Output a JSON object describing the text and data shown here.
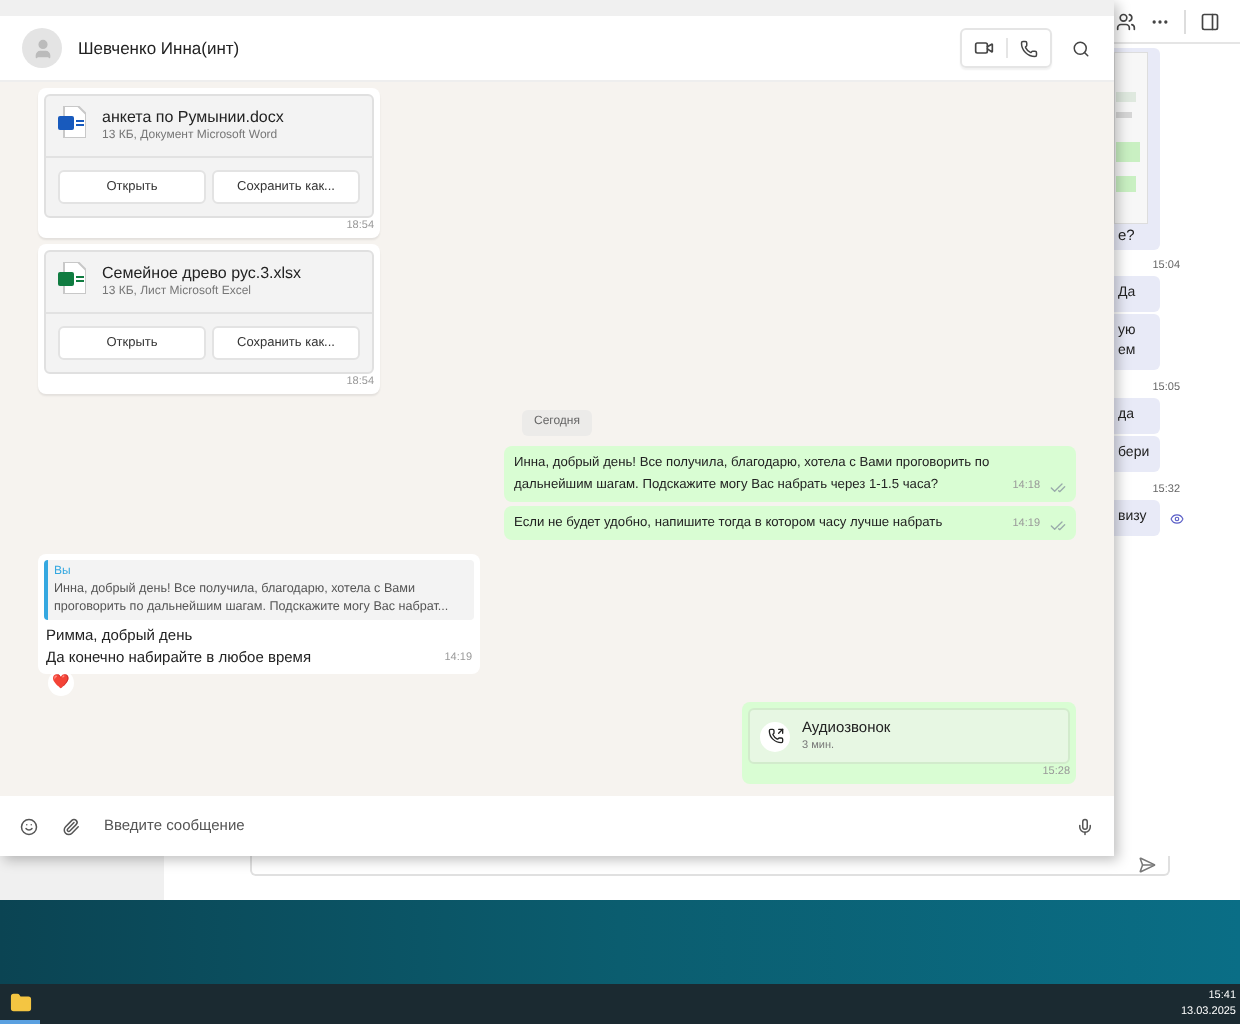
{
  "window": {
    "contact": "Шевченко Инна(инт)"
  },
  "messages": [
    {
      "kind": "file",
      "outgoing": false,
      "icon": {
        "kind": "word"
      },
      "name": "анкета по Румынии.docx",
      "meta": "13 КБ, Документ Microsoft Word",
      "buttons": [
        "Открыть",
        "Сохранить как..."
      ],
      "time": "18:54"
    },
    {
      "kind": "file",
      "outgoing": false,
      "icon": {
        "kind": "excel"
      },
      "name": "Семейное древо рус.3.xlsx",
      "meta": "13 КБ, Лист Microsoft Excel",
      "buttons": [
        "Открыть",
        "Сохранить как..."
      ],
      "time": "18:54"
    },
    {
      "kind": "date",
      "text": "Сегодня"
    },
    {
      "kind": "text",
      "outgoing": true,
      "text": "Инна, добрый день! Все получила, благодарю, хотела с Вами проговорить по дальнейшим шагам. Подскажите могу Вас набрать через 1-1.5 часа?",
      "time": "14:18",
      "read": false
    },
    {
      "kind": "text",
      "outgoing": true,
      "text": "Если не будет удобно, напишите тогда в котором часу лучше набрать",
      "time": "14:19",
      "read": false
    },
    {
      "kind": "reply",
      "outgoing": false,
      "quote_author": "Вы",
      "quote_text": "Инна, добрый день! Все получила, благодарю, хотела с Вами проговорить по дальнейшим шагам. Подскажите могу Вас набрат...",
      "lines": [
        "Римма, добрый день",
        "Да конечно набирайте в любое время"
      ],
      "time": "14:19",
      "reaction": "❤️"
    },
    {
      "kind": "call",
      "outgoing": true,
      "title": "Аудиозвонок",
      "duration": "3 мин.",
      "time": "15:28"
    }
  ],
  "composer": {
    "placeholder": "Введите сообщение"
  },
  "background_chat": [
    {
      "text": "е?"
    },
    {
      "kind": "time",
      "text": "15:04"
    },
    {
      "kind": "bubble",
      "lines": [
        "Да"
      ]
    },
    {
      "kind": "bubble",
      "lines": [
        "ую",
        "ем"
      ]
    },
    {
      "kind": "time",
      "text": "15:05"
    },
    {
      "kind": "bubble",
      "lines": [
        "да"
      ]
    },
    {
      "kind": "bubble",
      "lines": [
        "бери"
      ]
    },
    {
      "kind": "time",
      "text": "15:32"
    },
    {
      "kind": "bubble",
      "lines": [
        "визу"
      ],
      "seen": true
    }
  ],
  "taskbar": {
    "time": "15:41",
    "date": "13.03.2025"
  }
}
